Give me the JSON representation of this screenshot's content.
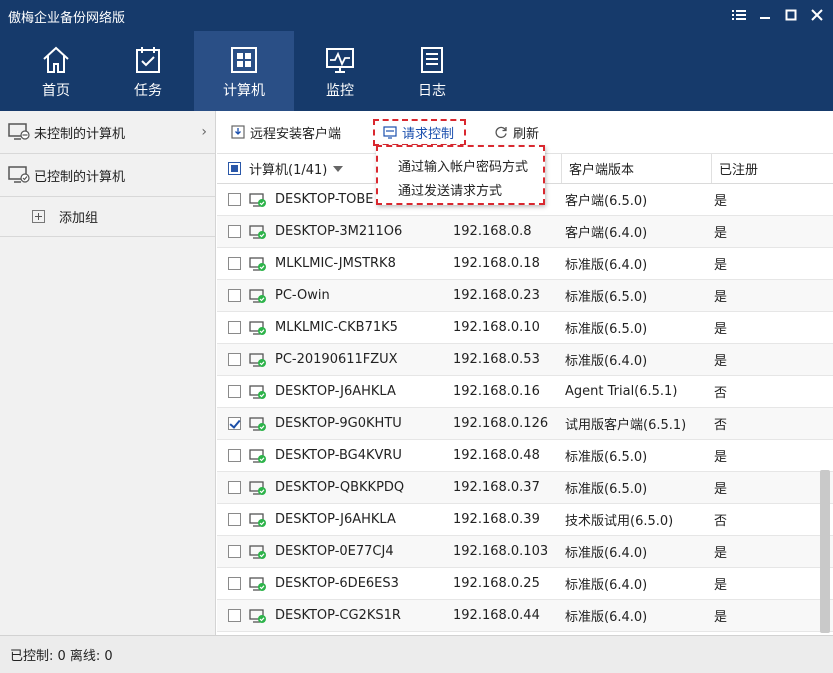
{
  "window": {
    "title": "傲梅企业备份网络版",
    "controls": [
      "menu-icon",
      "minimize-icon",
      "maximize-icon",
      "close-icon"
    ]
  },
  "nav": {
    "items": [
      {
        "label": "首页",
        "icon": "home-icon"
      },
      {
        "label": "任务",
        "icon": "tasks-icon"
      },
      {
        "label": "计算机",
        "icon": "computers-icon"
      },
      {
        "label": "监控",
        "icon": "monitor-icon"
      },
      {
        "label": "日志",
        "icon": "log-icon"
      }
    ],
    "active_index": 2
  },
  "sidebar": {
    "items": [
      {
        "label": "未控制的计算机",
        "icon": "uncontrolled-computer-icon"
      },
      {
        "label": "已控制的计算机",
        "icon": "controlled-computer-icon"
      }
    ],
    "add_group_label": "添加组"
  },
  "toolbar": {
    "remote_install_label": "远程安装客户端",
    "request_control_label": "请求控制",
    "refresh_label": "刷新"
  },
  "dropdown": {
    "items": [
      "通过输入帐户密码方式",
      "通过发送请求方式"
    ]
  },
  "table": {
    "headers": {
      "name": "计算机(1/41)",
      "ip": "",
      "version": "客户端版本",
      "registered": "已注册"
    },
    "rows": [
      {
        "name": "DESKTOP-TOBE",
        "ip": "",
        "version": "客户端(6.5.0)",
        "registered": "是",
        "checked": false
      },
      {
        "name": "DESKTOP-3M211O6",
        "ip": "192.168.0.8",
        "version": "客户端(6.4.0)",
        "registered": "是",
        "checked": false
      },
      {
        "name": "MLKLMIC-JMSTRK8",
        "ip": "192.168.0.18",
        "version": "标准版(6.4.0)",
        "registered": "是",
        "checked": false
      },
      {
        "name": "PC-Owin",
        "ip": "192.168.0.23",
        "version": "标准版(6.5.0)",
        "registered": "是",
        "checked": false
      },
      {
        "name": "MLKLMIC-CKB71K5",
        "ip": "192.168.0.10",
        "version": "标准版(6.5.0)",
        "registered": "是",
        "checked": false
      },
      {
        "name": "PC-20190611FZUX",
        "ip": "192.168.0.53",
        "version": "标准版(6.4.0)",
        "registered": "是",
        "checked": false
      },
      {
        "name": "DESKTOP-J6AHKLA",
        "ip": "192.168.0.16",
        "version": "Agent Trial(6.5.1)",
        "registered": "否",
        "checked": false
      },
      {
        "name": "DESKTOP-9G0KHTU",
        "ip": "192.168.0.126",
        "version": "试用版客户端(6.5.1)",
        "registered": "否",
        "checked": true
      },
      {
        "name": "DESKTOP-BG4KVRU",
        "ip": "192.168.0.48",
        "version": "标准版(6.5.0)",
        "registered": "是",
        "checked": false
      },
      {
        "name": "DESKTOP-QBKKPDQ",
        "ip": "192.168.0.37",
        "version": "标准版(6.5.0)",
        "registered": "是",
        "checked": false
      },
      {
        "name": "DESKTOP-J6AHKLA",
        "ip": "192.168.0.39",
        "version": "技术版试用(6.5.0)",
        "registered": "否",
        "checked": false
      },
      {
        "name": "DESKTOP-0E77CJ4",
        "ip": "192.168.0.103",
        "version": "标准版(6.4.0)",
        "registered": "是",
        "checked": false
      },
      {
        "name": "DESKTOP-6DE6ES3",
        "ip": "192.168.0.25",
        "version": "标准版(6.4.0)",
        "registered": "是",
        "checked": false
      },
      {
        "name": "DESKTOP-CG2KS1R",
        "ip": "192.168.0.44",
        "version": "标准版(6.4.0)",
        "registered": "是",
        "checked": false
      }
    ]
  },
  "status": {
    "text": "已控制: 0 离线: 0"
  },
  "colors": {
    "header_bg": "#163a6b",
    "nav_active_bg": "#2a4f86",
    "accent_blue": "#1a4fae",
    "highlight_red": "#d9282f",
    "online_green": "#2db34a"
  }
}
